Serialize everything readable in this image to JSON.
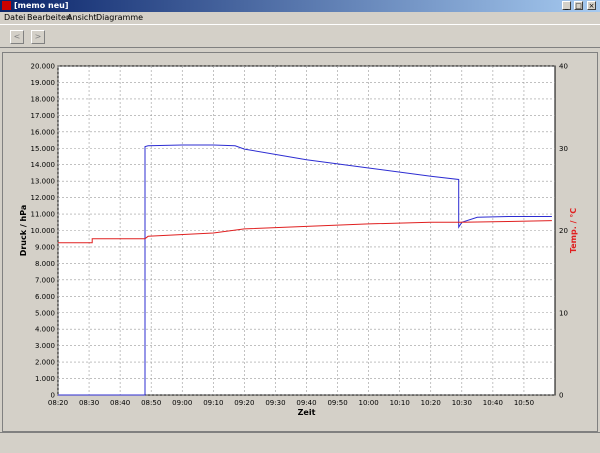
{
  "window": {
    "title": "[memo neu]",
    "minimize": "_",
    "maximize": "□",
    "close": "×"
  },
  "menu": [
    "Datei",
    "Bearbeiten",
    "Ansicht",
    "Diagramme"
  ],
  "toolbar": {
    "back": "<",
    "forward": ">"
  },
  "colors": {
    "pressure": "#2d2dd2",
    "temperature": "#e02020",
    "grid": "#9a9a9a"
  },
  "chart_data": {
    "type": "line",
    "xlabel": "Zeit",
    "ylabel": "Druck / hPa",
    "y2label": "Temp. / °C",
    "xlim": [
      "08:20",
      "11:00"
    ],
    "ylim": [
      0,
      20000
    ],
    "y2lim": [
      0,
      40
    ],
    "x_ticks": [
      "08:20",
      "08:30",
      "08:40",
      "08:50",
      "09:00",
      "09:10",
      "09:20",
      "09:30",
      "09:40",
      "09:50",
      "10:00",
      "10:10",
      "10:20",
      "10:30",
      "10:40",
      "10:50"
    ],
    "y_ticks": [
      "0",
      "1.000",
      "2.000",
      "3.000",
      "4.000",
      "5.000",
      "6.000",
      "7.000",
      "8.000",
      "9.000",
      "10.000",
      "11.000",
      "12.000",
      "13.000",
      "14.000",
      "15.000",
      "16.000",
      "17.000",
      "18.000",
      "19.000",
      "20.000"
    ],
    "y2_ticks": [
      "0",
      "10",
      "20",
      "30",
      "40"
    ],
    "grid": true,
    "series": [
      {
        "axis": "left",
        "color": "#2d2dd2",
        "x": [
          "08:20",
          "08:48",
          "08:48",
          "08:49",
          "09:00",
          "09:10",
          "09:17",
          "09:20",
          "09:40",
          "10:00",
          "10:20",
          "10:29",
          "10:29",
          "10:30",
          "10:35",
          "10:45",
          "10:55",
          "10:59"
        ],
        "y": [
          0,
          0,
          15100,
          15150,
          15200,
          15200,
          15150,
          14950,
          14300,
          13800,
          13300,
          13100,
          10200,
          10500,
          10800,
          10850,
          10850,
          10850
        ]
      },
      {
        "axis": "right",
        "color": "#e02020",
        "x": [
          "08:20",
          "08:31",
          "08:31",
          "08:48",
          "08:49",
          "09:10",
          "09:20",
          "09:40",
          "10:00",
          "10:20",
          "10:30",
          "10:45",
          "10:59"
        ],
        "y": [
          18.5,
          18.5,
          19.0,
          19.0,
          19.3,
          19.7,
          20.2,
          20.5,
          20.8,
          21.0,
          21.0,
          21.1,
          21.2
        ]
      }
    ]
  }
}
